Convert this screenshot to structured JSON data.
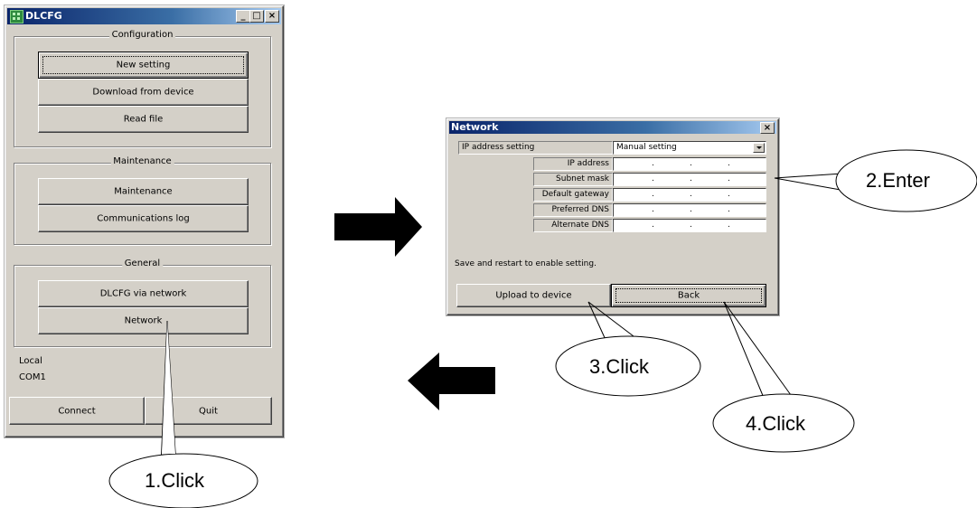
{
  "dlcfg": {
    "title": "DLCFG",
    "configuration": {
      "label": "Configuration",
      "buttons": [
        "New setting",
        "Download from device",
        "Read file"
      ]
    },
    "maintenance": {
      "label": "Maintenance",
      "buttons": [
        "Maintenance",
        "Communications log"
      ]
    },
    "general": {
      "label": "General",
      "buttons": [
        "DLCFG via network",
        "Network"
      ]
    },
    "status": {
      "location": "Local",
      "port": "COM1"
    },
    "connect_label": "Connect",
    "quit_label": "Quit"
  },
  "network": {
    "title": "Network",
    "ip_setting_label": "IP address setting",
    "ip_setting_value": "Manual setting",
    "fields": [
      "IP address",
      "Subnet mask",
      "Default gateway",
      "Preferred DNS",
      "Alternate DNS"
    ],
    "field_dots": ".",
    "note": "Save and restart to enable setting.",
    "upload_label": "Upload to device",
    "back_label": "Back"
  },
  "callouts": [
    "1.Click",
    "2.Enter",
    "3.Click",
    "4.Click"
  ],
  "icons": [
    "app-icon",
    "minimize-icon",
    "maximize-icon",
    "close-icon",
    "chevron-down-icon",
    "arrow-right-icon",
    "arrow-left-icon"
  ]
}
